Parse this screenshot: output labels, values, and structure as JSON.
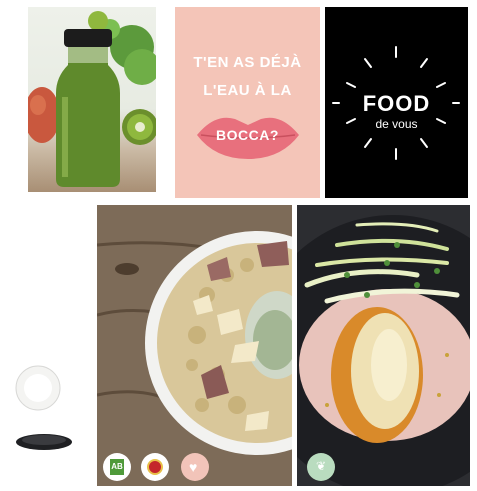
{
  "pink_tile": {
    "line1": "T'EN AS DÉJÀ",
    "line2": "L'EAU À LA",
    "line3": "BOCCA?"
  },
  "black_tile": {
    "logo_main": "FOOD",
    "logo_sub": "de vous"
  },
  "badges": {
    "ab_label": "AB",
    "ab_color": "#4f9a3a",
    "aop_color": "#c4252b",
    "heart_color": "#f2c4b9",
    "leaf_color": "#b9dcbf"
  }
}
